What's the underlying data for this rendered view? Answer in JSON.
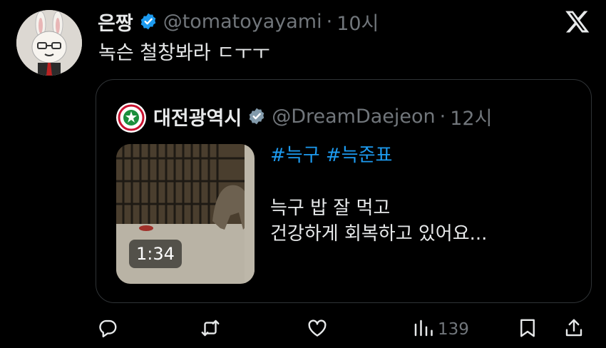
{
  "post": {
    "author_name": "은짱",
    "author_handle": "@tomatoyayami",
    "separator": "·",
    "time": "10시",
    "text": "녹슨 철창봐라 ㄷㅜㅜ"
  },
  "quote": {
    "author_name": "대전광역시",
    "author_handle": "@DreamDaejeon",
    "separator": "·",
    "time": "12시",
    "hashtags": "#늑구 #늑준표",
    "line1": "늑구 밥 잘 먹고",
    "line2": "건강하게 회복하고 있어요...",
    "video_duration": "1:34"
  },
  "actions": {
    "views_count": "139"
  },
  "colors": {
    "background": "#000000",
    "text": "#e7e9ea",
    "muted": "#71767b",
    "accent": "#1d9bf0",
    "border": "#2f3336"
  },
  "icons": [
    "verified-badge-icon",
    "x-logo-icon",
    "reply-icon",
    "repost-icon",
    "like-icon",
    "views-icon",
    "bookmark-icon",
    "share-icon"
  ]
}
